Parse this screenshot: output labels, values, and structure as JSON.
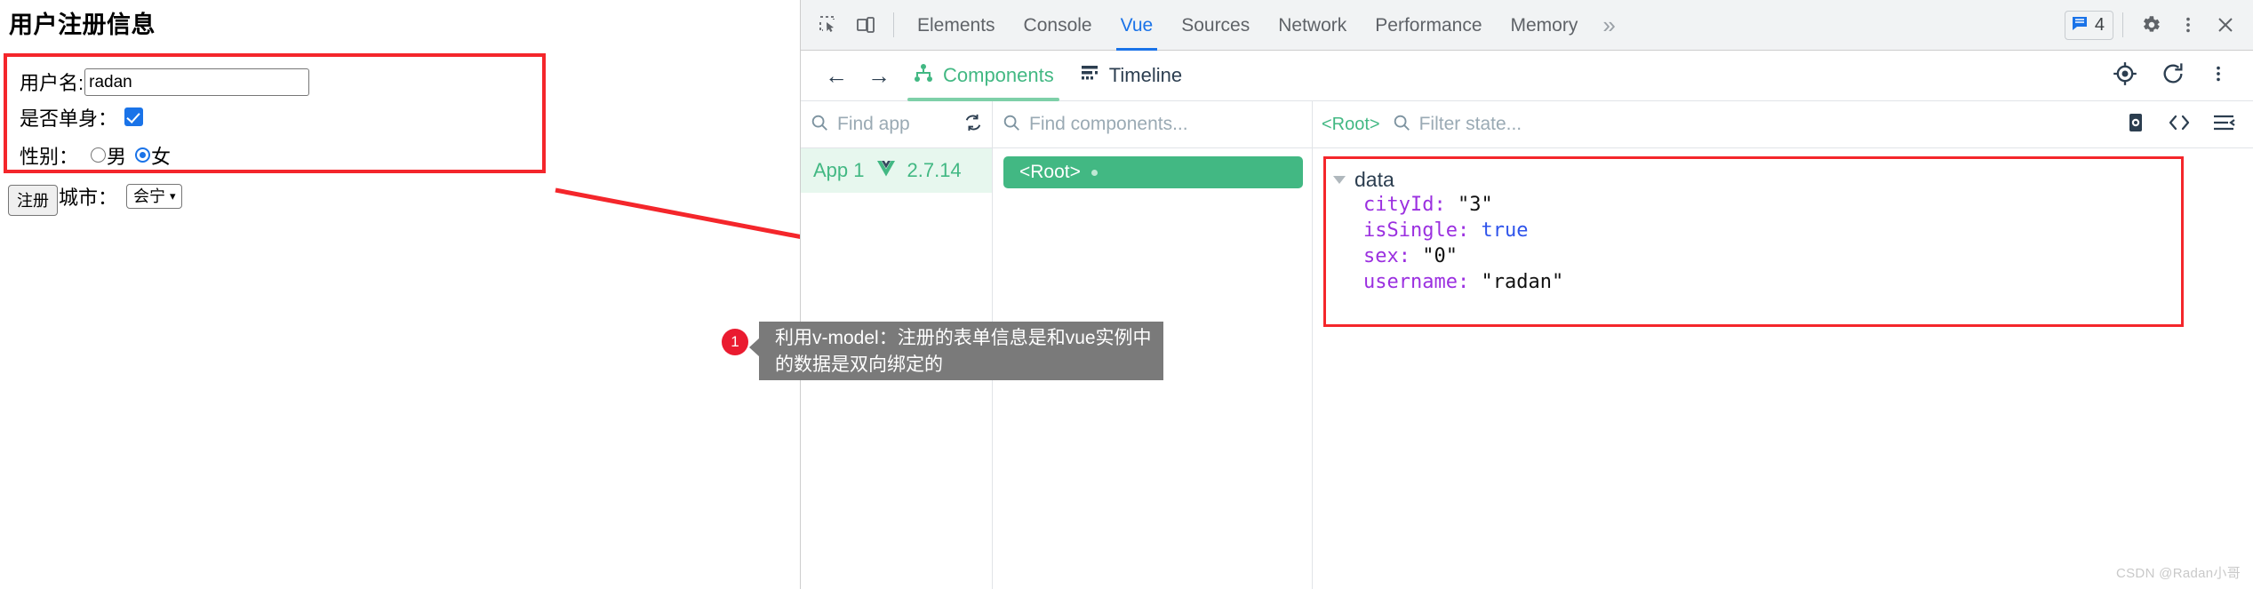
{
  "webpage": {
    "title": "用户注册信息",
    "form": {
      "username": {
        "label": "用户名:",
        "value": "radan"
      },
      "single": {
        "label": "是否单身：",
        "checked": true
      },
      "sex": {
        "label": "性别：",
        "options": [
          {
            "label": "男",
            "checked": false
          },
          {
            "label": "女",
            "checked": true
          }
        ]
      },
      "city": {
        "label": "所在城市：",
        "selected": "会宁"
      }
    },
    "register_button": "注册"
  },
  "callout": {
    "number": "1",
    "text": "利用v-model：注册的表单信息是和vue实例中的数据是双向绑定的"
  },
  "devtools": {
    "topbar": {
      "inspect_icon": "inspect-element-icon",
      "device_icon": "device-toolbar-icon",
      "tabs": [
        {
          "label": "Elements",
          "active": false
        },
        {
          "label": "Console",
          "active": false
        },
        {
          "label": "Vue",
          "active": true
        },
        {
          "label": "Sources",
          "active": false
        },
        {
          "label": "Network",
          "active": false
        },
        {
          "label": "Performance",
          "active": false
        },
        {
          "label": "Memory",
          "active": false
        }
      ],
      "more_tabs": "»",
      "issues_count": "4",
      "issues_icon": "issues-message-icon",
      "settings_icon": "gear-icon",
      "kebab_icon": "more-vertical-icon",
      "close_icon": "close-icon",
      "accent": "#1a73e8"
    },
    "vue_toolbar": {
      "back": "←",
      "forward": "→",
      "tabs": [
        {
          "label": "Components",
          "active": true,
          "icon": "component-tree-icon"
        },
        {
          "label": "Timeline",
          "active": false,
          "icon": "timeline-icon"
        }
      ],
      "right_icons": [
        "target-icon",
        "refresh-icon",
        "more-vertical-icon"
      ],
      "accent": "#42b883"
    },
    "apps_panel": {
      "search_placeholder": "Find app",
      "refresh_icon": "sync-icon",
      "app_name": "App 1",
      "vue_logo": "vue-logo-icon",
      "app_version": "2.7.14"
    },
    "tree_panel": {
      "search_placeholder": "Find components...",
      "selected_node": "<Root>"
    },
    "state_panel": {
      "breadcrumb": "<Root>",
      "filter_placeholder": "Filter state...",
      "right_icons": [
        "inspect-dom-icon",
        "open-in-editor-icon",
        "collapse-all-icon"
      ],
      "group_label": "data",
      "entries": [
        {
          "key": "cityId",
          "value": "\"3\"",
          "type": "string"
        },
        {
          "key": "isSingle",
          "value": "true",
          "type": "boolean"
        },
        {
          "key": "sex",
          "value": "\"0\"",
          "type": "string"
        },
        {
          "key": "username",
          "value": "\"radan\"",
          "type": "string"
        }
      ]
    }
  },
  "watermark": "CSDN @Radan小哥"
}
